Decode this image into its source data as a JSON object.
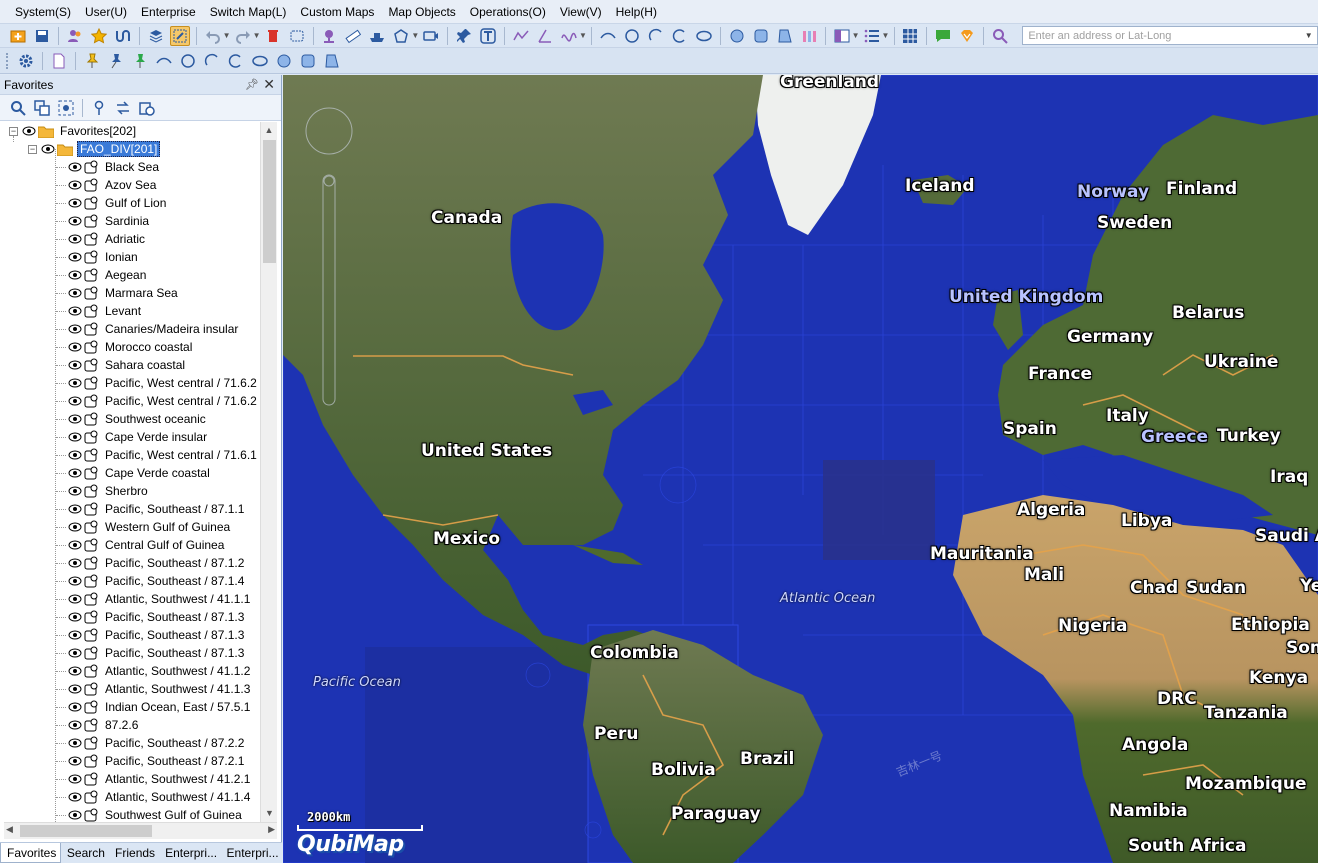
{
  "menu": [
    "System(S)",
    "User(U)",
    "Enterprise",
    "Switch Map(L)",
    "Custom Maps",
    "Map Objects",
    "Operations(O)",
    "View(V)",
    "Help(H)"
  ],
  "address": {
    "placeholder": "Enter an address or Lat-Long",
    "value": ""
  },
  "panel": {
    "title": "Favorites",
    "root": "Favorites[202]",
    "folder": "FAO_DIV[201]",
    "items": [
      "Black Sea",
      "Azov Sea",
      "Gulf of Lion",
      "Sardinia",
      "Adriatic",
      "Ionian",
      "Aegean",
      "Marmara Sea",
      "Levant",
      "Canaries/Madeira insular",
      "Morocco coastal",
      "Sahara coastal",
      "Pacific, West central / 71.6.2",
      "Pacific, West central / 71.6.2",
      "Southwest oceanic",
      "Cape Verde insular",
      "Pacific, West central / 71.6.1",
      "Cape Verde coastal",
      "Sherbro",
      "Pacific, Southeast / 87.1.1",
      "Western Gulf of Guinea",
      "Central Gulf of Guinea",
      "Pacific, Southeast / 87.1.2",
      "Pacific, Southeast / 87.1.4",
      "Atlantic, Southwest / 41.1.1",
      "Pacific, Southeast / 87.1.3",
      "Pacific, Southeast / 87.1.3",
      "Pacific, Southeast / 87.1.3",
      "Atlantic, Southwest / 41.1.2",
      "Atlantic, Southwest / 41.1.3",
      "Indian Ocean, East / 57.5.1",
      "87.2.6",
      "Pacific, Southeast / 87.2.2",
      "Pacific, Southeast / 87.2.1",
      "Atlantic, Southwest / 41.2.1",
      "Atlantic, Southwest / 41.1.4",
      "Southwest Gulf of Guinea"
    ]
  },
  "tabs": [
    "Favorites",
    "Search",
    "Friends",
    "Enterpri...",
    "Enterpri..."
  ],
  "map": {
    "labels": [
      {
        "text": "Greenland",
        "kind": "land"
      },
      {
        "text": "Canada",
        "kind": "land"
      },
      {
        "text": "Iceland",
        "kind": "land"
      },
      {
        "text": "Norway",
        "kind": "blue"
      },
      {
        "text": "Finland",
        "kind": "land"
      },
      {
        "text": "Sweden",
        "kind": "land"
      },
      {
        "text": "United Kingdom",
        "kind": "blue"
      },
      {
        "text": "Belarus",
        "kind": "land"
      },
      {
        "text": "Germany",
        "kind": "land"
      },
      {
        "text": "Ukraine",
        "kind": "land"
      },
      {
        "text": "France",
        "kind": "land"
      },
      {
        "text": "Italy",
        "kind": "land"
      },
      {
        "text": "Spain",
        "kind": "land"
      },
      {
        "text": "Greece",
        "kind": "blue"
      },
      {
        "text": "Turkey",
        "kind": "land"
      },
      {
        "text": "Iraq",
        "kind": "land"
      },
      {
        "text": "United States",
        "kind": "land"
      },
      {
        "text": "Algeria",
        "kind": "land"
      },
      {
        "text": "Libya",
        "kind": "land"
      },
      {
        "text": "Saudi Ar",
        "kind": "land"
      },
      {
        "text": "Mexico",
        "kind": "land"
      },
      {
        "text": "Mauritania",
        "kind": "land"
      },
      {
        "text": "Mali",
        "kind": "land"
      },
      {
        "text": "Chad",
        "kind": "land"
      },
      {
        "text": "Sudan",
        "kind": "land"
      },
      {
        "text": "Yem",
        "kind": "land"
      },
      {
        "text": "Atlantic Ocean",
        "kind": "ocean"
      },
      {
        "text": "Nigeria",
        "kind": "land"
      },
      {
        "text": "Ethiopia",
        "kind": "land"
      },
      {
        "text": "Colombia",
        "kind": "land"
      },
      {
        "text": "Som",
        "kind": "land"
      },
      {
        "text": "Pacific Ocean",
        "kind": "ocean"
      },
      {
        "text": "Kenya",
        "kind": "land"
      },
      {
        "text": "DRC",
        "kind": "land"
      },
      {
        "text": "Tanzania",
        "kind": "land"
      },
      {
        "text": "Peru",
        "kind": "land"
      },
      {
        "text": "Angola",
        "kind": "land"
      },
      {
        "text": "Brazil",
        "kind": "land"
      },
      {
        "text": "Bolivia",
        "kind": "land"
      },
      {
        "text": "Mozambique",
        "kind": "land"
      },
      {
        "text": "Namibia",
        "kind": "land"
      },
      {
        "text": "Paraguay",
        "kind": "land"
      },
      {
        "text": "South Africa",
        "kind": "land"
      }
    ],
    "scale": "2000km",
    "logo": "QubiMap",
    "watermark": "吉林一号"
  }
}
